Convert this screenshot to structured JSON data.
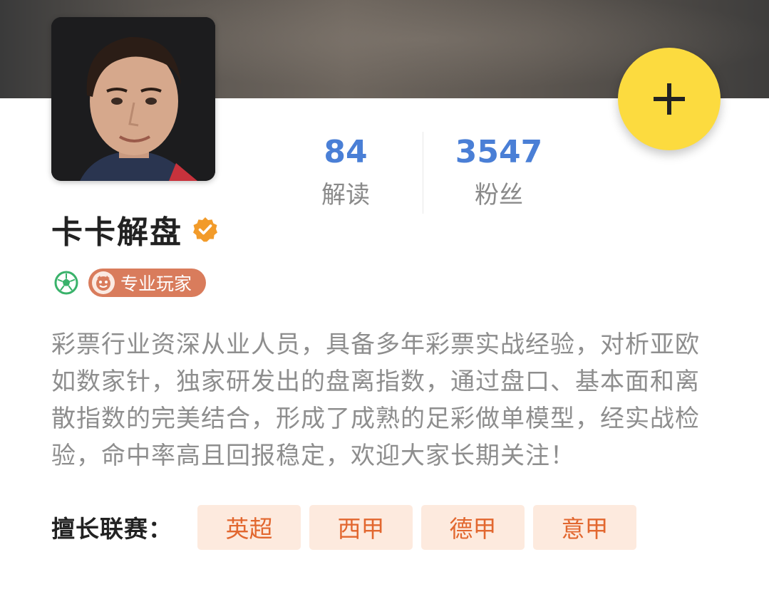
{
  "profile": {
    "name": "卡卡解盘",
    "badge_label": "专业玩家",
    "bio": "彩票行业资深从业人员，具备多年彩票实战经验，对析亚欧如数家针，独家研发出的盘离指数，通过盘口、基本面和离散指数的完美结合，形成了成熟的足彩做单模型，经实战检验，命中率高且回报稳定，欢迎大家长期关注！"
  },
  "stats": [
    {
      "value": "84",
      "label": "解读"
    },
    {
      "value": "3547",
      "label": "粉丝"
    }
  ],
  "leagues": {
    "label": "擅长联赛：",
    "items": [
      "英超",
      "西甲",
      "德甲",
      "意甲"
    ]
  },
  "icons": {
    "follow": "plus-icon",
    "verified": "verified-check-icon",
    "sport": "soccer-ball-icon",
    "badge": "mascot-face-icon"
  },
  "colors": {
    "accent_blue": "#4a7fd6",
    "fab_yellow": "#fcdb3f",
    "badge_orange": "#d97c5c",
    "tag_bg": "#fdeade",
    "tag_text": "#e2672f",
    "verified_orange": "#f29b2a",
    "soccer_green": "#39b26a"
  }
}
